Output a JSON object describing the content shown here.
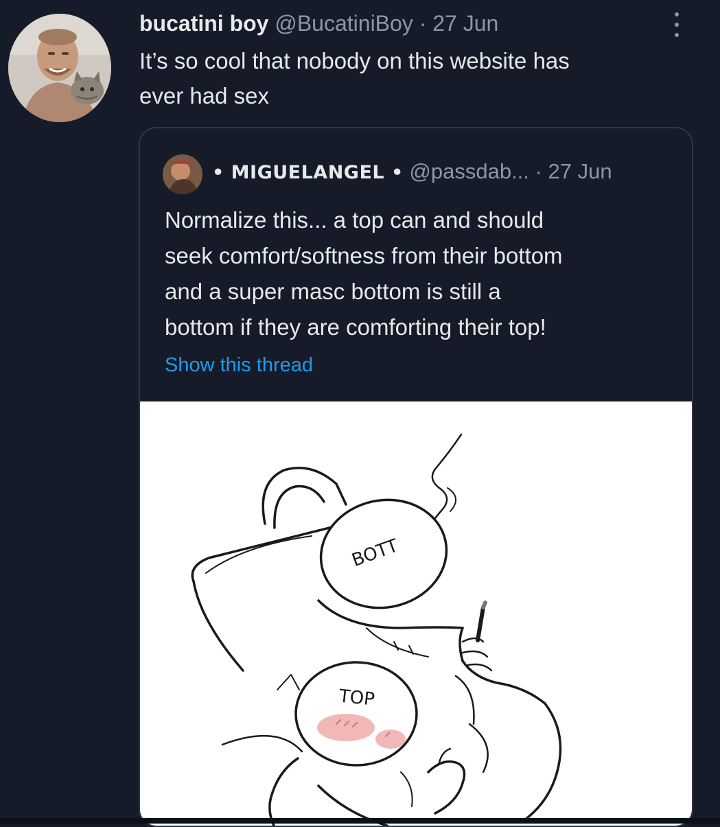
{
  "tweet": {
    "display_name": "bucatini boy",
    "handle": "@BucatiniBoy",
    "separator": "·",
    "date": "27 Jun",
    "text_line1": "It’s so cool that nobody on this website has",
    "text_line2": "ever had sex"
  },
  "quote": {
    "name": "• MIGUELANGEL •",
    "handle": "@passdab...",
    "separator": "·",
    "date": "27 Jun",
    "text_line1": "Normalize this... a top can and should",
    "text_line2": "seek comfort/softness from their bottom",
    "text_line3": "and a super masc bottom is still a",
    "text_line4": "bottom if they are comforting their top!",
    "show_thread": "Show this thread"
  },
  "media": {
    "label_bott": "BOTT",
    "label_top": "TOP"
  },
  "icons": {
    "more": "more-vertical-icon"
  },
  "colors": {
    "background": "#151b28",
    "text": "#e7e9ea",
    "secondary": "#8b98a5",
    "link": "#1d9bf0",
    "card_border": "#2f3945"
  }
}
